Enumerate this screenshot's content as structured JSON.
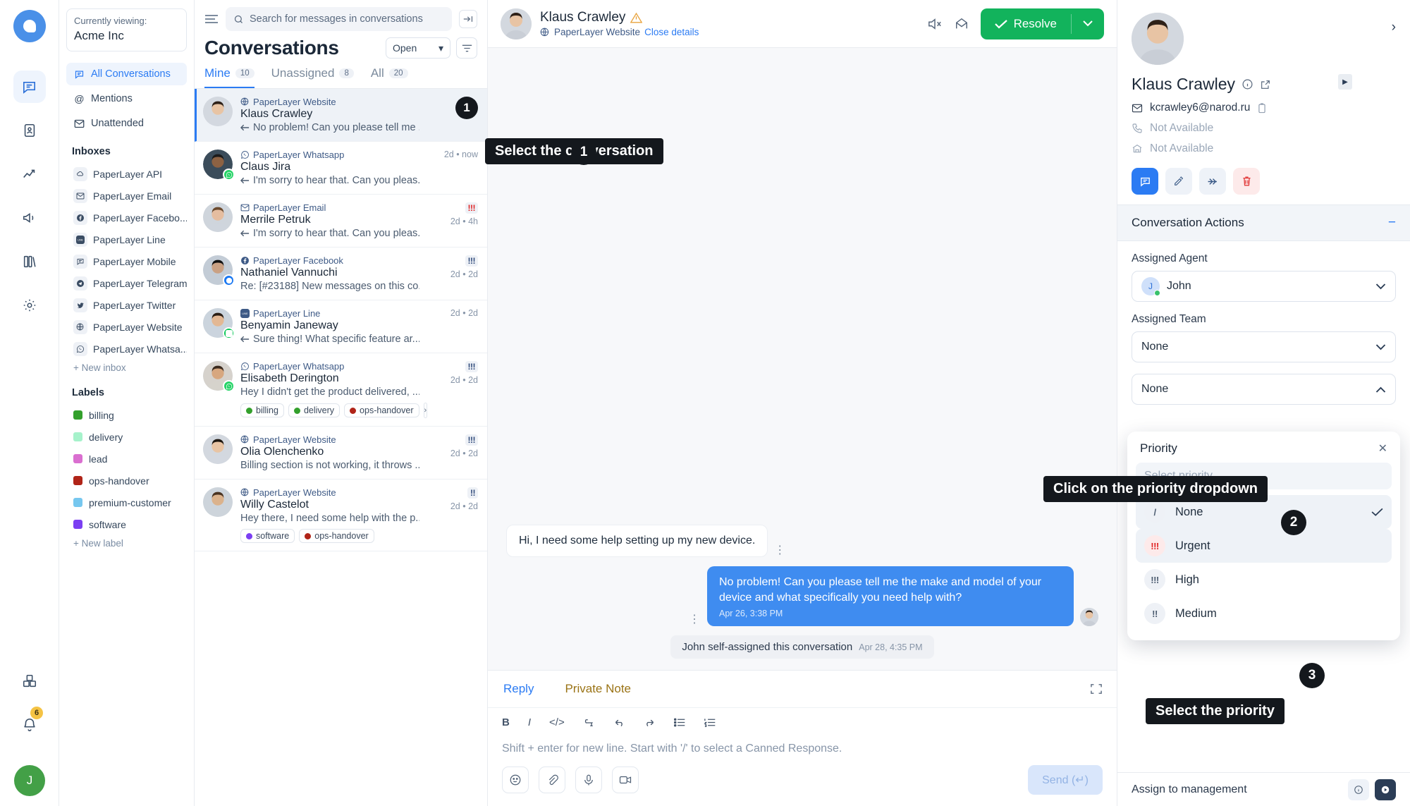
{
  "rail": {
    "logo_name": "app-logo",
    "items": [
      {
        "name": "conversations",
        "glyph": "◯",
        "active": true
      },
      {
        "name": "contacts",
        "glyph": "▭",
        "active": false
      },
      {
        "name": "reports",
        "glyph": "↗",
        "active": false
      },
      {
        "name": "campaigns",
        "glyph": "◁",
        "active": false
      },
      {
        "name": "help-center",
        "glyph": "▤",
        "active": false
      },
      {
        "name": "settings",
        "glyph": "⚙",
        "active": false
      }
    ],
    "bottom": [
      {
        "name": "integrations",
        "glyph": "⊞"
      },
      {
        "name": "notifications",
        "glyph": "○",
        "badge": "6"
      }
    ],
    "user_initial": "J"
  },
  "sidebar": {
    "viewing_label": "Currently viewing:",
    "account_name": "Acme Inc",
    "nav": [
      {
        "label": "All Conversations",
        "icon": "chat-icon",
        "active": true
      },
      {
        "label": "Mentions",
        "icon": "at-icon",
        "active": false
      },
      {
        "label": "Unattended",
        "icon": "envelope-icon",
        "active": false
      }
    ],
    "inboxes_heading": "Inboxes",
    "inboxes": [
      {
        "label": "PaperLayer API",
        "icon": "cloud-icon"
      },
      {
        "label": "PaperLayer Email",
        "icon": "envelope-icon"
      },
      {
        "label": "PaperLayer Facebo...",
        "icon": "facebook-icon"
      },
      {
        "label": "PaperLayer Line",
        "icon": "line-icon"
      },
      {
        "label": "PaperLayer Mobile",
        "icon": "chat-icon"
      },
      {
        "label": "PaperLayer Telegram",
        "icon": "telegram-icon"
      },
      {
        "label": "PaperLayer Twitter",
        "icon": "twitter-icon"
      },
      {
        "label": "PaperLayer Website",
        "icon": "globe-icon"
      },
      {
        "label": "PaperLayer Whatsa...",
        "icon": "whatsapp-icon"
      }
    ],
    "new_inbox": "+ New inbox",
    "labels_heading": "Labels",
    "labels": [
      {
        "label": "billing",
        "color": "#33a02c"
      },
      {
        "label": "delivery",
        "color": "#a6f2cb"
      },
      {
        "label": "lead",
        "color": "#da6fd0"
      },
      {
        "label": "ops-handover",
        "color": "#b02418"
      },
      {
        "label": "premium-customer",
        "color": "#76c7ef"
      },
      {
        "label": "software",
        "color": "#7b3ff2"
      }
    ],
    "new_label": "+ New label"
  },
  "conversation_list": {
    "search_placeholder": "Search for messages in conversations",
    "title": "Conversations",
    "status_filter": "Open",
    "tabs": [
      {
        "label": "Mine",
        "count": "10",
        "active": true
      },
      {
        "label": "Unassigned",
        "count": "8",
        "active": false
      },
      {
        "label": "All",
        "count": "20",
        "active": false
      }
    ],
    "items": [
      {
        "channel": "PaperLayer Website",
        "channel_icon": "globe-icon",
        "name": "Klaus Crawley",
        "preview": "No problem! Can you please tell me ...",
        "has_reply_arrow": true,
        "time": "",
        "priority": "",
        "selected": true,
        "badge_number": "1",
        "tags": []
      },
      {
        "channel": "PaperLayer Whatsapp",
        "channel_icon": "whatsapp-icon",
        "name": "Claus Jira",
        "preview": "I'm sorry to hear that. Can you pleas...",
        "has_reply_arrow": true,
        "time": "2d • now",
        "priority": "",
        "selected": false,
        "badge_number": "",
        "tags": []
      },
      {
        "channel": "PaperLayer Email",
        "channel_icon": "envelope-icon",
        "name": "Merrile Petruk",
        "preview": "I'm sorry to hear that. Can you pleas...",
        "has_reply_arrow": true,
        "time": "2d • 4h",
        "priority": "urgent",
        "priority_glyph": "!!!",
        "selected": false,
        "badge_number": "",
        "tags": []
      },
      {
        "channel": "PaperLayer Facebook",
        "channel_icon": "facebook-icon",
        "name": "Nathaniel Vannuchi",
        "preview": "Re: [#23188] New messages on this co...",
        "has_reply_arrow": false,
        "time": "2d • 2d",
        "priority": "high",
        "priority_glyph": "!!!",
        "selected": false,
        "badge_number": "",
        "tags": []
      },
      {
        "channel": "PaperLayer Line",
        "channel_icon": "line-icon",
        "name": "Benyamin Janeway",
        "preview": "Sure thing! What specific feature ar...",
        "has_reply_arrow": true,
        "time": "2d • 2d",
        "priority": "",
        "selected": false,
        "badge_number": "",
        "tags": []
      },
      {
        "channel": "PaperLayer Whatsapp",
        "channel_icon": "whatsapp-icon",
        "name": "Elisabeth Derington",
        "preview": "Hey I didn't get the product delivered, ...",
        "has_reply_arrow": false,
        "time": "2d • 2d",
        "priority": "high",
        "priority_glyph": "!!!",
        "selected": false,
        "badge_number": "",
        "tags": [
          {
            "label": "billing",
            "color": "#33a02c"
          },
          {
            "label": "delivery",
            "color": "#33a02c"
          },
          {
            "label": "ops-handover",
            "color": "#b02418"
          }
        ],
        "tags_more": "›"
      },
      {
        "channel": "PaperLayer Website",
        "channel_icon": "globe-icon",
        "name": "Olia Olenchenko",
        "preview": "Billing section is not working, it throws ...",
        "has_reply_arrow": false,
        "time": "2d • 2d",
        "priority": "high",
        "priority_glyph": "!!!",
        "selected": false,
        "badge_number": "",
        "tags": []
      },
      {
        "channel": "PaperLayer Website",
        "channel_icon": "globe-icon",
        "name": "Willy Castelot",
        "preview": "Hey there, I need some help with the p...",
        "has_reply_arrow": false,
        "time": "2d • 2d",
        "priority": "medium",
        "priority_glyph": "!!",
        "selected": false,
        "badge_number": "",
        "tags": [
          {
            "label": "software",
            "color": "#7b3ff2"
          },
          {
            "label": "ops-handover",
            "color": "#b02418"
          }
        ]
      }
    ]
  },
  "chat_header": {
    "name": "Klaus Crawley",
    "warning_icon": "warning-icon",
    "channel": "PaperLayer Website",
    "close_details": "Close details",
    "resolve_label": "Resolve"
  },
  "messages": [
    {
      "type": "incoming",
      "text": "Hi, I need some help setting up my new device.",
      "time": ""
    },
    {
      "type": "outgoing",
      "text": "No problem! Can you please tell me the make and model of your device and what specifically you need help with?",
      "time": "Apr 26, 3:38 PM"
    },
    {
      "type": "system",
      "text": "John self-assigned this conversation",
      "time": "Apr 28, 4:35 PM"
    }
  ],
  "composer": {
    "tabs": [
      {
        "label": "Reply",
        "active": true
      },
      {
        "label": "Private Note",
        "active": false
      }
    ],
    "format_tools": [
      "bold-icon",
      "italic-icon",
      "code-icon",
      "link-icon",
      "undo-icon",
      "redo-icon",
      "bullet-list-icon",
      "numbered-list-icon"
    ],
    "placeholder": "Shift + enter for new line. Start with '/' to select a Canned Response.",
    "bottom_tools": [
      "emoji-icon",
      "attachment-icon",
      "microphone-icon",
      "video-icon"
    ],
    "send_label": "Send (↵)"
  },
  "contact_panel": {
    "name": "Klaus Crawley",
    "email": "kcrawley6@narod.ru",
    "phone": "Not Available",
    "company": "Not Available",
    "actions": [
      "chat-icon",
      "edit-icon",
      "merge-icon",
      "delete-icon"
    ],
    "section_title": "Conversation Actions",
    "assigned_agent_label": "Assigned Agent",
    "assigned_agent": "John",
    "assigned_agent_initial": "J",
    "assigned_team_label": "Assigned Team",
    "assigned_team": "None",
    "priority_value": "None",
    "assign_to_management": "Assign to management"
  },
  "priority_popover": {
    "title": "Priority",
    "search_placeholder": "Select priority",
    "options": [
      {
        "label": "None",
        "glyph": "/",
        "selected": true,
        "style": "none"
      },
      {
        "label": "Urgent",
        "glyph": "!!!",
        "selected": false,
        "style": "urgent",
        "highlighted": true
      },
      {
        "label": "High",
        "glyph": "!!!",
        "selected": false,
        "style": "high"
      },
      {
        "label": "Medium",
        "glyph": "!!",
        "selected": false,
        "style": "medium"
      }
    ]
  },
  "callouts": [
    {
      "text": "Select the conversation",
      "step": "1"
    },
    {
      "text": "Click on the priority dropdown",
      "step": "2"
    },
    {
      "text": "Select the priority",
      "step": "3"
    }
  ],
  "colors": {
    "accent": "#2b7bf3",
    "resolve_green": "#12b35c",
    "urgent_red": "#e02424",
    "bubble_out": "#3f8cf0"
  }
}
